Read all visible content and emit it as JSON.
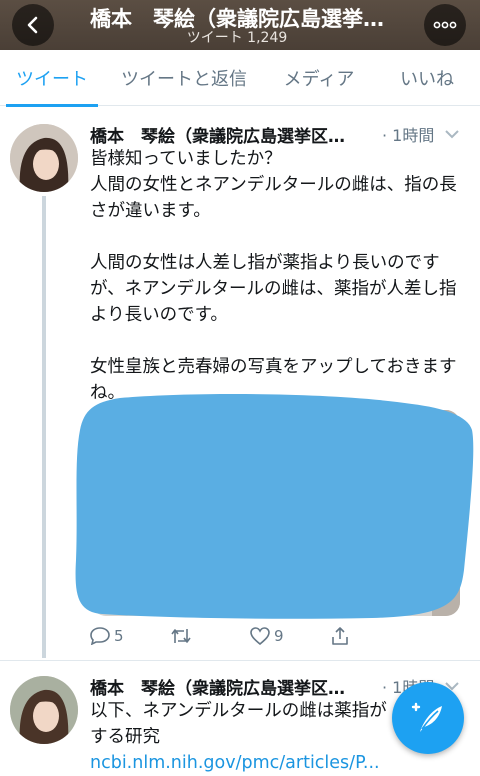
{
  "header": {
    "title": "橋本　琴絵（衆議院広島選挙…",
    "subtitle": "ツイート 1,249",
    "back_icon": "chevron-left-icon",
    "more_label": "∘∘∘"
  },
  "tabs": [
    {
      "label": "ツイート",
      "active": true
    },
    {
      "label": "ツイートと返信",
      "active": false
    },
    {
      "label": "メディア",
      "active": false
    },
    {
      "label": "いいね",
      "active": false
    }
  ],
  "tweets": [
    {
      "name": "橋本　琴絵（衆議院広島選挙区…",
      "time": "· 1時間",
      "text": "皆様知っていましたか？\n人間の女性とネアンデルタールの雌は、指の長さが違います。\n\n人間の女性は人差し指が薬指より長いのですが、ネアンデルタールの雌は、薬指が人差し指より長いのです。\n\n女性皇族と売春婦の写真をアップしておきますね。",
      "actions": {
        "reply_count": "5",
        "retweet_count": "",
        "like_count": "9"
      }
    },
    {
      "name": "橋本　琴絵（衆議院広島選挙区…",
      "time": "· 1時間",
      "text": "以下、ネアンデルタールの雌は薬指が",
      "text2": "する研究",
      "link": "ncbi.nlm.nih.gov/pmc/articles/P..."
    }
  ],
  "colors": {
    "accent": "#1da1f2",
    "header_bg": "#4f443a",
    "scribble": "#5aaee3",
    "muted": "#657786"
  }
}
